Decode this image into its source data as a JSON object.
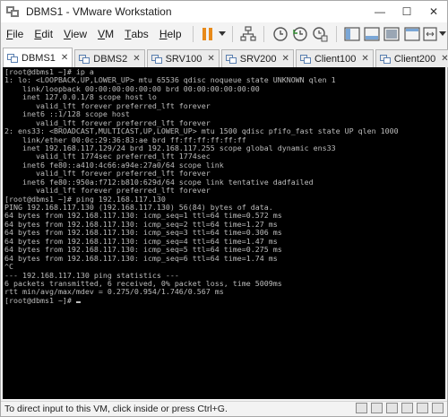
{
  "window": {
    "title": "DBMS1 - VMware Workstation",
    "controls": {
      "minimize": "—",
      "maximize": "☐",
      "close": "✕"
    }
  },
  "menu": {
    "items": [
      {
        "key": "file",
        "label": "File",
        "accel": "F",
        "rest": "ile"
      },
      {
        "key": "edit",
        "label": "Edit",
        "accel": "E",
        "rest": "dit"
      },
      {
        "key": "view",
        "label": "View",
        "accel": "V",
        "rest": "iew"
      },
      {
        "key": "vm",
        "label": "VM",
        "accel": "V",
        "rest": "M"
      },
      {
        "key": "tabs",
        "label": "Tabs",
        "accel": "T",
        "rest": "abs"
      },
      {
        "key": "help",
        "label": "Help",
        "accel": "H",
        "rest": "elp"
      }
    ]
  },
  "tabs": [
    {
      "label": "DBMS1",
      "active": true
    },
    {
      "label": "DBMS2",
      "active": false
    },
    {
      "label": "SRV100",
      "active": false
    },
    {
      "label": "SRV200",
      "active": false
    },
    {
      "label": "Client100",
      "active": false
    },
    {
      "label": "Client200",
      "active": false
    }
  ],
  "console": {
    "lines": [
      "[root@dbms1 ~]# ip a",
      "1: lo: <LOOPBACK,UP,LOWER_UP> mtu 65536 qdisc noqueue state UNKNOWN qlen 1",
      "    link/loopback 00:00:00:00:00:00 brd 00:00:00:00:00:00",
      "    inet 127.0.0.1/8 scope host lo",
      "       valid_lft forever preferred_lft forever",
      "    inet6 ::1/128 scope host",
      "       valid_lft forever preferred_lft forever",
      "2: ens33: <BROADCAST,MULTICAST,UP,LOWER_UP> mtu 1500 qdisc pfifo_fast state UP qlen 1000",
      "    link/ether 00:0c:29:36:83:ae brd ff:ff:ff:ff:ff:ff",
      "    inet 192.168.117.129/24 brd 192.168.117.255 scope global dynamic ens33",
      "       valid_lft 1774sec preferred_lft 1774sec",
      "    inet6 fe80::a410:4c66:a94e:27a0/64 scope link",
      "       valid_lft forever preferred_lft forever",
      "    inet6 fe80::950a:f712:b810:629d/64 scope link tentative dadfailed",
      "       valid_lft forever preferred_lft forever",
      "[root@dbms1 ~]# ping 192.168.117.130",
      "PING 192.168.117.130 (192.168.117.130) 56(84) bytes of data.",
      "64 bytes from 192.168.117.130: icmp_seq=1 ttl=64 time=0.572 ms",
      "64 bytes from 192.168.117.130: icmp_seq=2 ttl=64 time=1.27 ms",
      "64 bytes from 192.168.117.130: icmp_seq=3 ttl=64 time=0.306 ms",
      "64 bytes from 192.168.117.130: icmp_seq=4 ttl=64 time=1.47 ms",
      "64 bytes from 192.168.117.130: icmp_seq=5 ttl=64 time=0.275 ms",
      "64 bytes from 192.168.117.130: icmp_seq=6 ttl=64 time=1.74 ms",
      "^C",
      "--- 192.168.117.130 ping statistics ---",
      "6 packets transmitted, 6 received, 0% packet loss, time 5009ms",
      "rtt min/avg/max/mdev = 0.275/0.954/1.746/0.567 ms"
    ],
    "prompt": "[root@dbms1 ~]# "
  },
  "status": {
    "text": "To direct input to this VM, click inside or press Ctrl+G."
  },
  "colors": {
    "pause_accent": "#e88a1a",
    "console_bg": "#000000",
    "console_fg": "#bdbdbd"
  }
}
